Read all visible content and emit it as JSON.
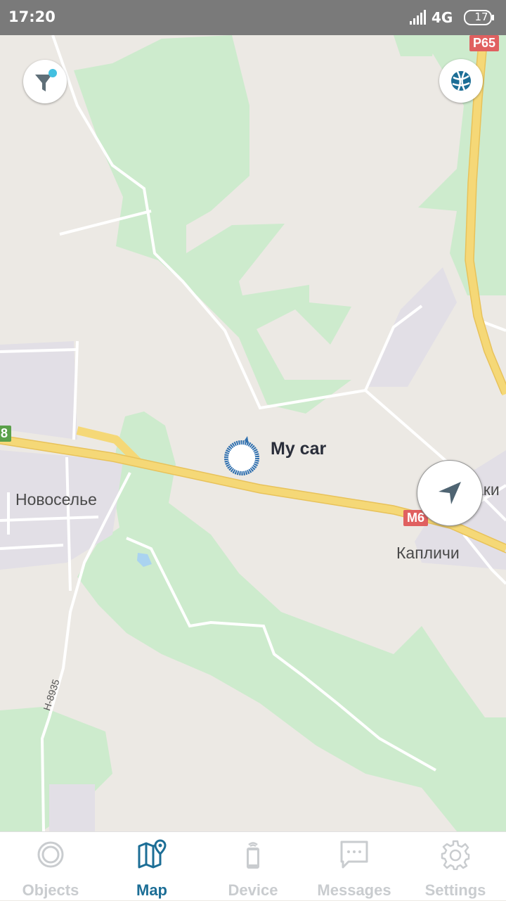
{
  "status_bar": {
    "time": "17:20",
    "network": "4G",
    "battery": "17"
  },
  "map": {
    "places": [
      "Новоселье",
      "Капличи",
      "аки"
    ],
    "road_badges": [
      {
        "label": "P65",
        "color": "#e06060"
      },
      {
        "label": "M6",
        "color": "#e06060"
      },
      {
        "label": "8",
        "color": "#5aa04a"
      },
      {
        "label": "H-8935"
      }
    ],
    "marker": {
      "label": "My car",
      "color": "#2f6fae"
    }
  },
  "controls": {
    "filter_icon": "filter-icon",
    "layers_icon": "globe-icon",
    "navigate_icon": "navigation-arrow-icon"
  },
  "bottom_nav": {
    "active": "Map",
    "accent": "#1c6e96",
    "items": [
      {
        "label": "Objects",
        "icon": "objects-icon"
      },
      {
        "label": "Map",
        "icon": "map-icon"
      },
      {
        "label": "Device",
        "icon": "device-icon"
      },
      {
        "label": "Messages",
        "icon": "messages-icon"
      },
      {
        "label": "Settings",
        "icon": "settings-icon"
      }
    ]
  }
}
